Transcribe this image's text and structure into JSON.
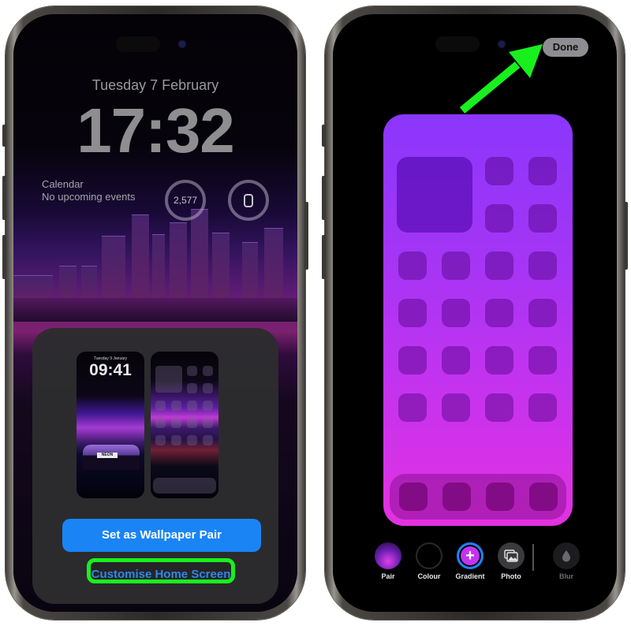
{
  "left_phone": {
    "lock_screen": {
      "date": "Tuesday 7 February",
      "time": "17:32",
      "calendar_widget": {
        "title": "Calendar",
        "subtitle": "No upcoming events"
      },
      "steps_widget": {
        "value": "2,577",
        "icon": "sneaker-icon"
      },
      "battery_widget": {
        "icon": "watch-charging-icon"
      }
    },
    "wallpaper_sheet": {
      "lock_preview": {
        "date": "Tuesday 9 January",
        "time": "09:41",
        "plate": "NEON"
      },
      "home_preview": {
        "description": "blurred home screen"
      },
      "primary_button": "Set as Wallpaper Pair",
      "secondary_button": "Customise Home Screen",
      "highlight_color": "#18f01e"
    }
  },
  "right_phone": {
    "done_button": "Done",
    "arrow_color": "#18f01e",
    "toolbar": [
      {
        "label": "Pair",
        "icon": "pair-thumbnail-icon",
        "selected": false,
        "dimmed": false
      },
      {
        "label": "Colour",
        "icon": "colour-swatch-icon",
        "selected": false,
        "dimmed": false
      },
      {
        "label": "Gradient",
        "icon": "plus-icon",
        "selected": true,
        "dimmed": false
      },
      {
        "label": "Photo",
        "icon": "photo-icon",
        "selected": false,
        "dimmed": false
      },
      {
        "label": "Blur",
        "icon": "drop-icon",
        "selected": false,
        "dimmed": true
      }
    ],
    "preview_gradient": [
      "#8b36fc",
      "#e331e0"
    ],
    "accent_color": "#1a84f5"
  }
}
